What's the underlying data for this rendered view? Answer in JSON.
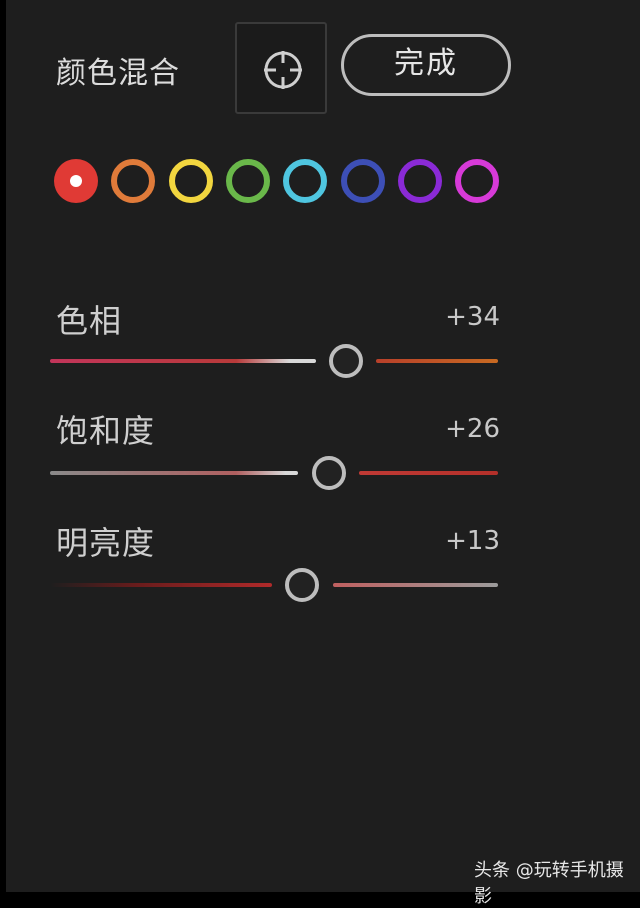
{
  "header": {
    "title": "颜色混合",
    "target_tool_icon": "crosshair-target-icon",
    "done_label": "完成"
  },
  "colors": [
    {
      "name": "red",
      "hex": "#e03a35",
      "selected": true
    },
    {
      "name": "orange",
      "hex": "#e07b3a",
      "selected": false
    },
    {
      "name": "yellow",
      "hex": "#f2d63f",
      "selected": false
    },
    {
      "name": "green",
      "hex": "#6ab84a",
      "selected": false
    },
    {
      "name": "aqua",
      "hex": "#4fc6e0",
      "selected": false
    },
    {
      "name": "blue",
      "hex": "#3d4fb6",
      "selected": false
    },
    {
      "name": "purple",
      "hex": "#8a2ad6",
      "selected": false
    },
    {
      "name": "magenta",
      "hex": "#d73ad8",
      "selected": false
    }
  ],
  "sliders": [
    {
      "key": "hue",
      "label": "色相",
      "value": "+34",
      "numeric": 34,
      "left_color": "#c2355a",
      "right_color": "#c25a22"
    },
    {
      "key": "saturation",
      "label": "饱和度",
      "value": "+26",
      "numeric": 26,
      "left_color": "#a8a8a8",
      "right_color": "#b33a35"
    },
    {
      "key": "luminance",
      "label": "明亮度",
      "value": "+13",
      "numeric": 13,
      "left_color": "#3a1010",
      "right_color": "#9c9c9c"
    }
  ],
  "watermark": "头条 @玩转手机摄影"
}
